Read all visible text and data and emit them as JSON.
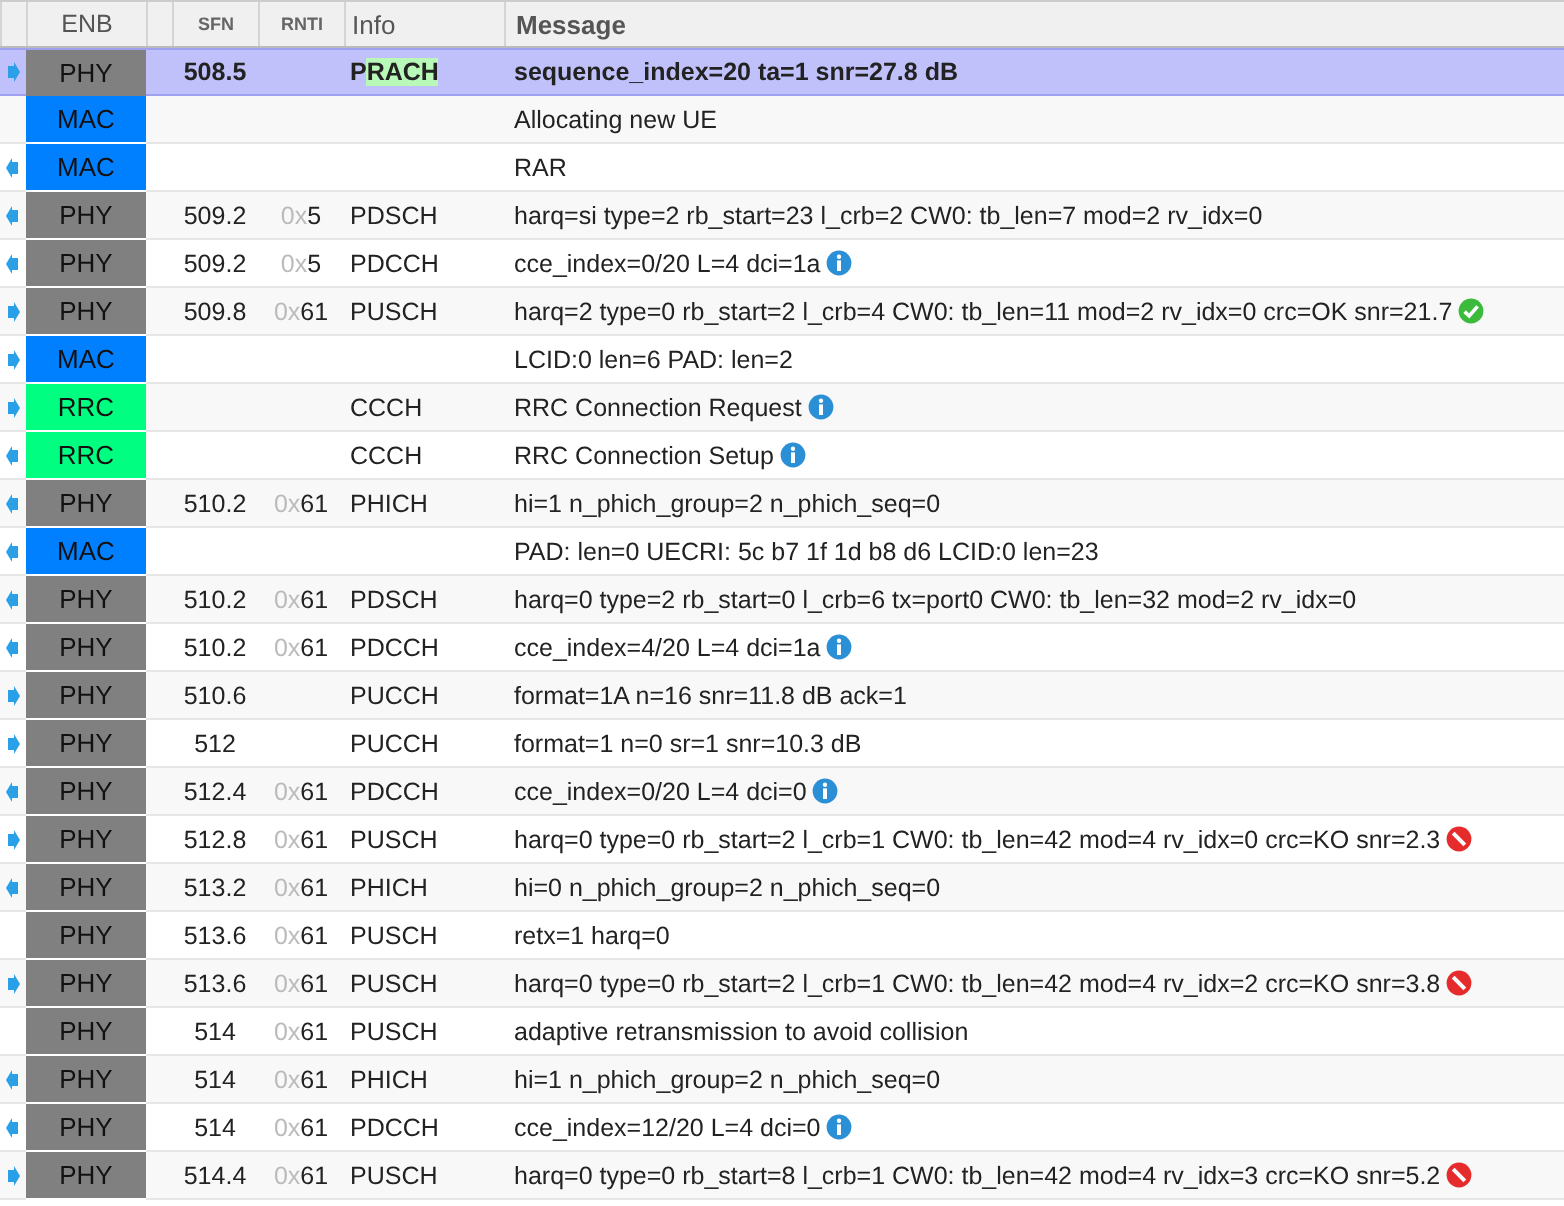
{
  "table": {
    "columns": [
      "ENB",
      "SFN",
      "RNTI",
      "Info",
      "Message"
    ],
    "rows": [
      {
        "kind": "uplink",
        "layer": "PHY",
        "color": "#808080",
        "sfn": "508.5",
        "info": "P",
        "info_mark": "RACH",
        "message": "sequence_index=20 ta=1 snr=27.8 dB",
        "selected": true
      },
      {
        "layer": "MAC",
        "color": "#0080ff",
        "message": "Allocating new UE",
        "selected": false
      },
      {
        "kind": "downlink",
        "layer": "MAC",
        "color": "#0080ff",
        "message": "RAR",
        "selected": false
      },
      {
        "kind": "downlink",
        "layer": "PHY",
        "color": "#808080",
        "sfn": "509.2",
        "rnti": "0x5",
        "info": "PDSCH",
        "message": "harq=si type=2 rb_start=23 l_crb=2 CW0: tb_len=7 mod=2 rv_idx=0",
        "selected": false
      },
      {
        "kind": "downlink",
        "layer": "PHY",
        "color": "#808080",
        "sfn": "509.2",
        "rnti": "0x5",
        "info": "PDCCH",
        "message": "cce_index=0/20 L=4 dci=1a",
        "status": {
          "kind": "info"
        },
        "selected": false
      },
      {
        "kind": "uplink",
        "layer": "PHY",
        "color": "#808080",
        "sfn": "509.8",
        "rnti": "0x61",
        "info": "PUSCH",
        "message": "harq=2 type=0 rb_start=2 l_crb=4 CW0: tb_len=11 mod=2 rv_idx=0 crc=OK snr=21.7",
        "status": {
          "kind": "ok"
        },
        "selected": false
      },
      {
        "kind": "uplink",
        "layer": "MAC",
        "color": "#0080ff",
        "message": "LCID:0 len=6 PAD: len=2",
        "selected": false
      },
      {
        "kind": "uplink",
        "layer": "RRC",
        "color": "#00ff80",
        "info": "CCCH",
        "message": "RRC Connection Request",
        "status": {
          "kind": "info"
        },
        "selected": false
      },
      {
        "kind": "downlink",
        "layer": "RRC",
        "color": "#00ff80",
        "info": "CCCH",
        "message": "RRC Connection Setup",
        "status": {
          "kind": "info"
        },
        "selected": false
      },
      {
        "kind": "downlink",
        "layer": "PHY",
        "color": "#808080",
        "sfn": "510.2",
        "rnti": "0x61",
        "info": "PHICH",
        "message": "hi=1 n_phich_group=2 n_phich_seq=0",
        "selected": false
      },
      {
        "kind": "downlink",
        "layer": "MAC",
        "color": "#0080ff",
        "message": "PAD: len=0 UECRI: 5c b7 1f 1d b8 d6 LCID:0 len=23",
        "selected": false
      },
      {
        "kind": "downlink",
        "layer": "PHY",
        "color": "#808080",
        "sfn": "510.2",
        "rnti": "0x61",
        "info": "PDSCH",
        "message": "harq=0 type=2 rb_start=0 l_crb=6 tx=port0 CW0: tb_len=32 mod=2 rv_idx=0",
        "selected": false
      },
      {
        "kind": "downlink",
        "layer": "PHY",
        "color": "#808080",
        "sfn": "510.2",
        "rnti": "0x61",
        "info": "PDCCH",
        "message": "cce_index=4/20 L=4 dci=1a",
        "status": {
          "kind": "info"
        },
        "selected": false
      },
      {
        "kind": "uplink",
        "layer": "PHY",
        "color": "#808080",
        "sfn": "510.6",
        "info": "PUCCH",
        "message": "format=1A n=16 snr=11.8 dB ack=1",
        "selected": false
      },
      {
        "kind": "uplink",
        "layer": "PHY",
        "color": "#808080",
        "sfn": "512",
        "info": "PUCCH",
        "message": "format=1 n=0 sr=1 snr=10.3 dB",
        "selected": false
      },
      {
        "kind": "downlink",
        "layer": "PHY",
        "color": "#808080",
        "sfn": "512.4",
        "rnti": "0x61",
        "info": "PDCCH",
        "message": "cce_index=0/20 L=4 dci=0",
        "status": {
          "kind": "info"
        },
        "selected": false
      },
      {
        "kind": "uplink",
        "layer": "PHY",
        "color": "#808080",
        "sfn": "512.8",
        "rnti": "0x61",
        "info": "PUSCH",
        "message": "harq=0 type=0 rb_start=2 l_crb=1 CW0: tb_len=42 mod=4 rv_idx=0 crc=KO snr=2.3",
        "status": {
          "kind": "error"
        },
        "selected": false
      },
      {
        "kind": "downlink",
        "layer": "PHY",
        "color": "#808080",
        "sfn": "513.2",
        "rnti": "0x61",
        "info": "PHICH",
        "message": "hi=0 n_phich_group=2 n_phich_seq=0",
        "selected": false
      },
      {
        "layer": "PHY",
        "color": "#808080",
        "sfn": "513.6",
        "rnti": "0x61",
        "info": "PUSCH",
        "message": "retx=1 harq=0",
        "selected": false
      },
      {
        "kind": "uplink",
        "layer": "PHY",
        "color": "#808080",
        "sfn": "513.6",
        "rnti": "0x61",
        "info": "PUSCH",
        "message": "harq=0 type=0 rb_start=2 l_crb=1 CW0: tb_len=42 mod=4 rv_idx=2 crc=KO snr=3.8",
        "status": {
          "kind": "error"
        },
        "selected": false
      },
      {
        "layer": "PHY",
        "color": "#808080",
        "sfn": "514",
        "rnti": "0x61",
        "info": "PUSCH",
        "message": "adaptive retransmission to avoid collision",
        "selected": false
      },
      {
        "kind": "downlink",
        "layer": "PHY",
        "color": "#808080",
        "sfn": "514",
        "rnti": "0x61",
        "info": "PHICH",
        "message": "hi=1 n_phich_group=2 n_phich_seq=0",
        "selected": false
      },
      {
        "kind": "downlink",
        "layer": "PHY",
        "color": "#808080",
        "sfn": "514",
        "rnti": "0x61",
        "info": "PDCCH",
        "message": "cce_index=12/20 L=4 dci=0",
        "status": {
          "kind": "info"
        },
        "selected": false
      },
      {
        "kind": "uplink",
        "layer": "PHY",
        "color": "#808080",
        "sfn": "514.4",
        "rnti": "0x61",
        "info": "PUSCH",
        "message": "harq=0 type=0 rb_start=8 l_crb=1 CW0: tb_len=42 mod=4 rv_idx=3 crc=KO snr=5.2",
        "status": {
          "kind": "error"
        },
        "selected": false
      }
    ]
  }
}
